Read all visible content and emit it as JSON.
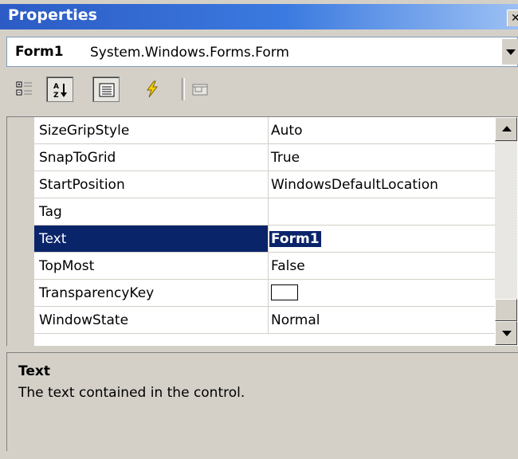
{
  "window": {
    "title": "Properties",
    "close_glyph": "✕"
  },
  "object_selector": {
    "name": "Form1",
    "type": "System.Windows.Forms.Form"
  },
  "toolbar": {
    "buttons": [
      {
        "icon": "categorized-icon",
        "pressed": false
      },
      {
        "icon": "alphabetical-icon",
        "pressed": true
      },
      {
        "icon": "properties-icon",
        "pressed": true
      },
      {
        "icon": "events-icon",
        "pressed": false
      },
      {
        "icon": "property-pages-icon",
        "pressed": false
      }
    ]
  },
  "grid": {
    "rows": [
      {
        "name": "SizeGripStyle",
        "value": "Auto"
      },
      {
        "name": "SnapToGrid",
        "value": "True"
      },
      {
        "name": "StartPosition",
        "value": "WindowsDefaultLocation"
      },
      {
        "name": "Tag",
        "value": ""
      },
      {
        "name": "Text",
        "value": "Form1",
        "selected": true
      },
      {
        "name": "TopMost",
        "value": "False"
      },
      {
        "name": "TransparencyKey",
        "value": "",
        "color_swatch": "#ffffff"
      },
      {
        "name": "WindowState",
        "value": "Normal"
      }
    ]
  },
  "description": {
    "title": "Text",
    "text": "The text contained in the control."
  },
  "colors": {
    "selection": "#0a246a",
    "chrome": "#d4d0c8",
    "title_start": "#2c5bc5"
  }
}
